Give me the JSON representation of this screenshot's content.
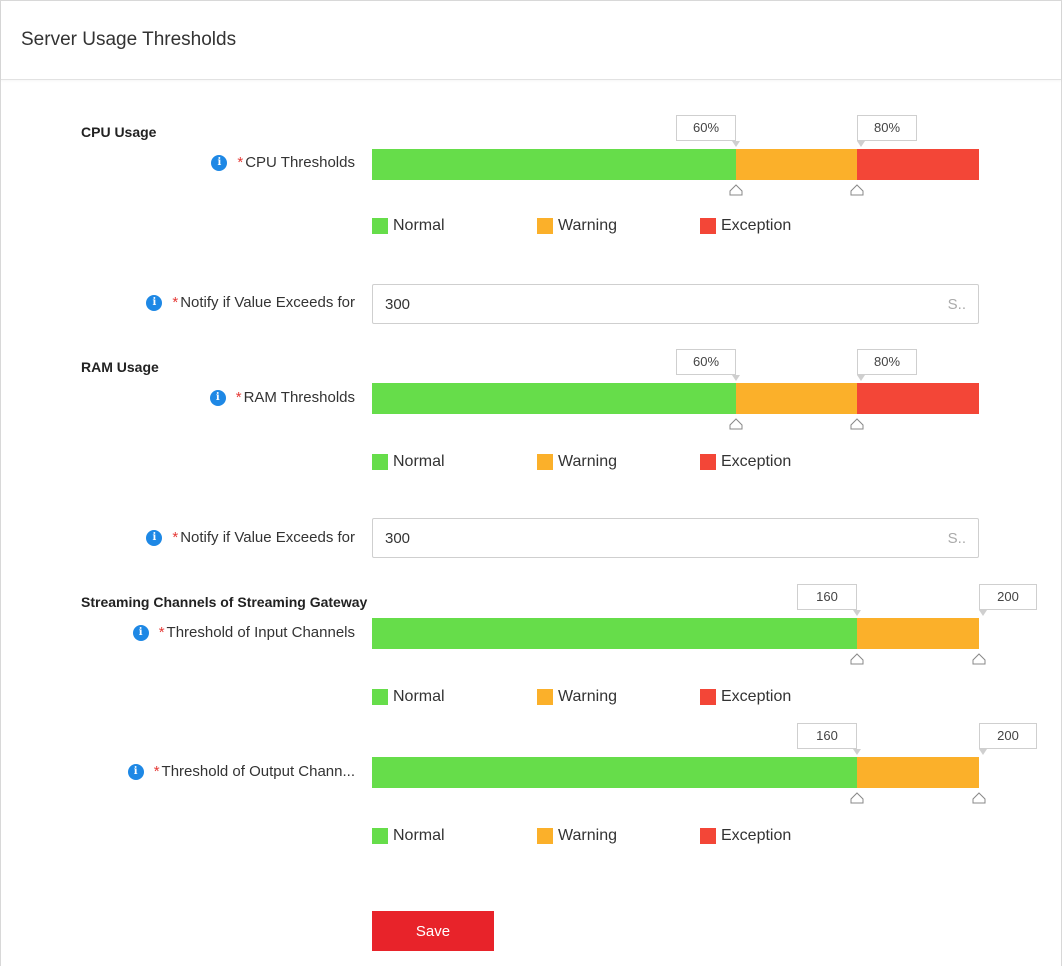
{
  "header": {
    "title": "Server Usage Thresholds"
  },
  "colors": {
    "normal": "#66dd4a",
    "warning": "#fbb02a",
    "exception": "#f34637",
    "accent": "#e8232a",
    "info": "#1e88e5"
  },
  "legend": {
    "normal": "Normal",
    "warning": "Warning",
    "exception": "Exception"
  },
  "cpu": {
    "section_title": "CPU Usage",
    "threshold_label": "CPU Thresholds",
    "low_marker": "60%",
    "high_marker": "80%",
    "low_value": 0.6,
    "high_value": 0.8,
    "notify_label": "Notify if Value Exceeds for",
    "notify_value": "300",
    "notify_unit": "S.."
  },
  "ram": {
    "section_title": "RAM Usage",
    "threshold_label": "RAM Thresholds",
    "low_marker": "60%",
    "high_marker": "80%",
    "low_value": 0.6,
    "high_value": 0.8,
    "notify_label": "Notify if Value Exceeds for",
    "notify_value": "300",
    "notify_unit": "S.."
  },
  "streaming": {
    "section_title": "Streaming Channels of Streaming Gateway",
    "input_label": "Threshold of Input Channels",
    "input_low_marker": "160",
    "input_high_marker": "200",
    "output_label": "Threshold of Output Chann...",
    "output_low_marker": "160",
    "output_high_marker": "200"
  },
  "save_label": "Save",
  "required_mark": "*",
  "info_glyph": "i"
}
